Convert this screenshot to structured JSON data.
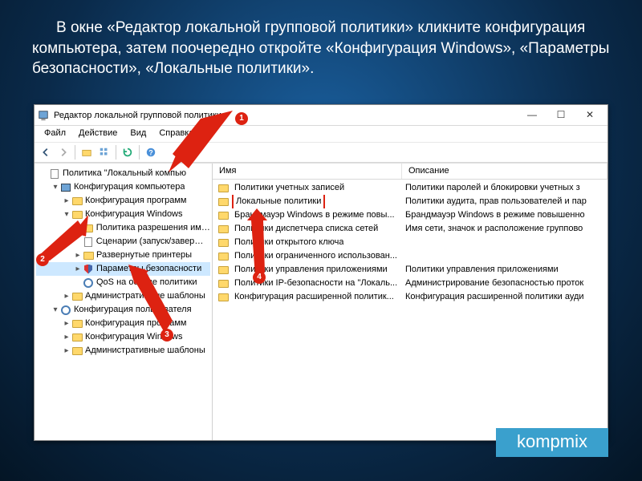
{
  "caption": "В окне «Редактор локальной групповой политики» кликните конфигурация компьютера, затем поочередно откройте «Конфигурация Windows», «Параметры безопасности», «Локальные политики».",
  "window": {
    "title": "Редактор локальной групповой политики",
    "controls": {
      "min": "—",
      "max": "☐",
      "close": "✕"
    }
  },
  "menu": [
    "Файл",
    "Действие",
    "Вид",
    "Справка"
  ],
  "columns": {
    "name": "Имя",
    "desc": "Описание"
  },
  "tree": [
    {
      "indent": 0,
      "tw": "",
      "icon": "doc",
      "label": "Политика \"Локальный компью"
    },
    {
      "indent": 1,
      "tw": "▾",
      "icon": "pc",
      "label": "Конфигурация компьютера"
    },
    {
      "indent": 2,
      "tw": "▸",
      "icon": "folder",
      "label": "Конфигурация программ"
    },
    {
      "indent": 2,
      "tw": "▾",
      "icon": "folder",
      "label": "Конфигурация Windows"
    },
    {
      "indent": 3,
      "tw": "",
      "icon": "folder",
      "label": "Политика разрешения имен"
    },
    {
      "indent": 3,
      "tw": "",
      "icon": "doc",
      "label": "Сценарии (запуск/завершен"
    },
    {
      "indent": 3,
      "tw": "▸",
      "icon": "folder",
      "label": "Развернутые принтеры"
    },
    {
      "indent": 3,
      "tw": "▸",
      "icon": "shield",
      "label": "Параметры безопасности",
      "sel": true
    },
    {
      "indent": 3,
      "tw": "",
      "icon": "gear",
      "label": "QoS на основе политики"
    },
    {
      "indent": 2,
      "tw": "▸",
      "icon": "folder",
      "label": "Административные шаблоны"
    },
    {
      "indent": 1,
      "tw": "▾",
      "icon": "gear",
      "label": "Конфигурация пользователя"
    },
    {
      "indent": 2,
      "tw": "▸",
      "icon": "folder",
      "label": "Конфигурация программ"
    },
    {
      "indent": 2,
      "tw": "▸",
      "icon": "folder",
      "label": "Конфигурация Windows"
    },
    {
      "indent": 2,
      "tw": "▸",
      "icon": "folder",
      "label": "Административные шаблоны"
    }
  ],
  "rows": [
    {
      "name": "Политики учетных записей",
      "desc": "Политики паролей и блокировки учетных з"
    },
    {
      "name": "Локальные политики",
      "desc": "Политики аудита, прав пользователей и пар",
      "hl": true
    },
    {
      "name": "Брандмауэр Windows в режиме повы...",
      "desc": "Брандмауэр Windows в режиме повышенно"
    },
    {
      "name": "Политики диспетчера списка сетей",
      "desc": "Имя сети, значок и расположение группово"
    },
    {
      "name": "Политики открытого ключа",
      "desc": ""
    },
    {
      "name": "Политики ограниченного использован...",
      "desc": ""
    },
    {
      "name": "Политики управления приложениями",
      "desc": "Политики управления приложениями"
    },
    {
      "name": "Политики IP-безопасности на \"Локаль...",
      "desc": "Администрирование безопасностью проток"
    },
    {
      "name": "Конфигурация расширенной политик...",
      "desc": "Конфигурация расширенной политики ауди"
    }
  ],
  "badges": [
    "1",
    "2",
    "3",
    "4"
  ],
  "watermark": "kompmix"
}
